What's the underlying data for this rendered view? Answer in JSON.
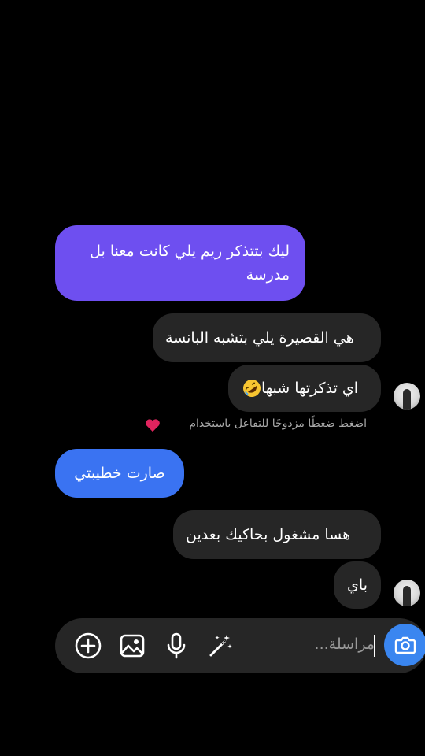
{
  "messages": [
    {
      "id": "m1",
      "side": "sent",
      "text": "ليك بتتذكر ريم يلي كانت معنا بل مدرسة",
      "color": "#6e4ff0"
    },
    {
      "id": "m2",
      "side": "received",
      "text": "هي القصيرة يلي بتشبه البانسة"
    },
    {
      "id": "m3",
      "side": "received",
      "text": "اي تذكرتها شبها",
      "emoji": "rolling-on-floor-laughing-emoji"
    },
    {
      "id": "m4",
      "side": "sent",
      "text": "صارت خطيبتي",
      "color": "#3a73f2"
    },
    {
      "id": "m5",
      "side": "received",
      "text": "هسا مشغول بحاكيك بعدين"
    },
    {
      "id": "m6",
      "side": "received",
      "text": "باي"
    }
  ],
  "reaction_hint": {
    "text": "اضغط ضغطًا مزدوجًا للتفاعل باستخدام",
    "icon": "red-heart-icon",
    "color": "#e0245e"
  },
  "composer": {
    "placeholder": "مراسلة...",
    "icons": [
      "add-icon",
      "gallery-icon",
      "microphone-icon",
      "magic-wand-icon"
    ],
    "camera_icon": "camera-icon",
    "camera_color": "#3a86f0"
  }
}
